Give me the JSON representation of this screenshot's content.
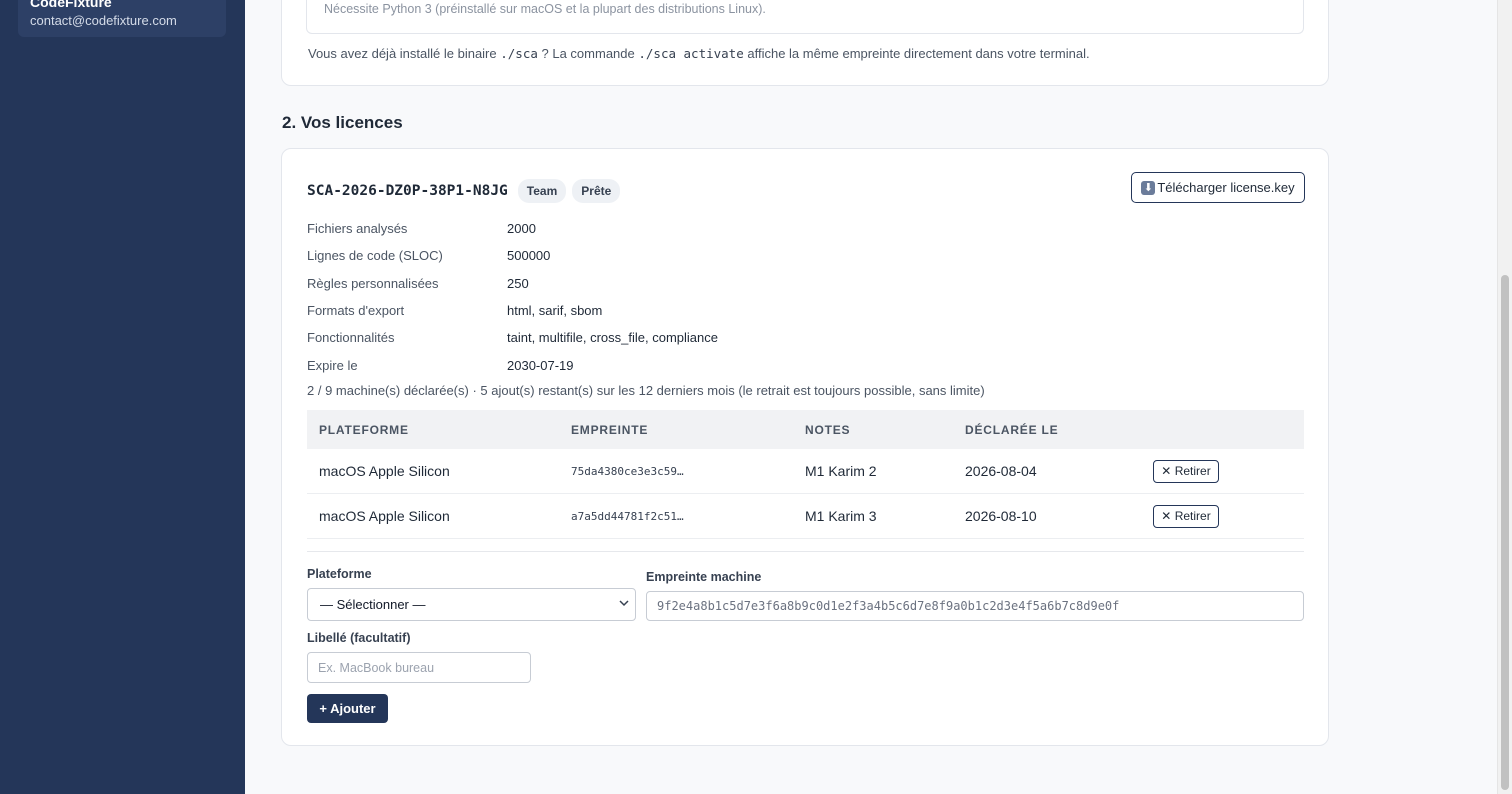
{
  "sidebar": {
    "user": {
      "name": "CodeFixture",
      "email": "contact@codefixture.com"
    }
  },
  "top_section": {
    "requirement": "Nécessite Python 3 (préinstallé sur macOS et la plupart des distributions Linux).",
    "note_prefix": "Vous avez déjà installé le binaire",
    "note_code1": "./sca",
    "note_mid": "? La commande",
    "note_code2": "./sca activate",
    "note_suffix": "affiche la même empreinte directement dans votre terminal."
  },
  "licenses_section": {
    "title": "2. Vos licences",
    "license": {
      "key": "SCA-2026-DZ0P-38P1-N8JG",
      "badges": [
        "Team",
        "Prête"
      ],
      "download_label": "Télécharger license.key",
      "download_icon": "download-icon",
      "properties": [
        {
          "label": "Fichiers analysés",
          "value": "2000"
        },
        {
          "label": "Lignes de code (SLOC)",
          "value": "500000"
        },
        {
          "label": "Règles personnalisées",
          "value": "250"
        },
        {
          "label": "Formats d'export",
          "value": "html, sarif, sbom"
        },
        {
          "label": "Fonctionnalités",
          "value": "taint, multifile, cross_file, compliance"
        },
        {
          "label": "Expire le",
          "value": "2030-07-19"
        }
      ],
      "machines_summary": "2 / 9 machine(s) déclarée(s) · 5 ajout(s) restant(s) sur les 12 derniers mois (le retrait est toujours possible, sans limite)",
      "table": {
        "headers": [
          "PLATEFORME",
          "EMPREINTE",
          "NOTES",
          "DÉCLARÉE LE",
          ""
        ],
        "rows": [
          {
            "platform": "macOS Apple Silicon",
            "fingerprint": "75da4380ce3e3c59…",
            "notes": "M1 Karim 2",
            "declared": "2026-08-04",
            "action": "Retirer"
          },
          {
            "platform": "macOS Apple Silicon",
            "fingerprint": "a7a5dd44781f2c51…",
            "notes": "M1 Karim 3",
            "declared": "2026-08-10",
            "action": "Retirer"
          }
        ]
      },
      "form": {
        "platform_label": "Plateforme",
        "platform_selected": "— Sélectionner —",
        "fingerprint_label": "Empreinte machine",
        "fingerprint_value": "9f2e4a8b1c5d7e3f6a8b9c0d1e2f3a4b5c6d7e8f9a0b1c2d3e4f5a6b7c8d9e0f",
        "note_label": "Libellé (facultatif)",
        "note_placeholder": "Ex. MacBook bureau",
        "add_label": "+ Ajouter"
      }
    }
  },
  "colors": {
    "sidebar": "#243659",
    "accent": "#243659",
    "background": "#f8f9fb"
  }
}
